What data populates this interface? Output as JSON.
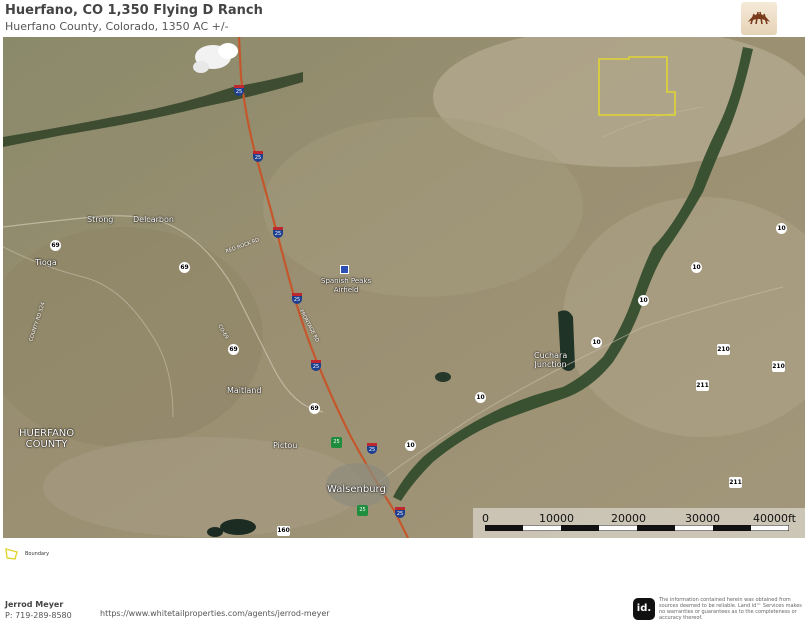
{
  "header": {
    "title": "Huerfano, CO 1,350 Flying D Ranch",
    "subtitle": "Huerfano County, Colorado, 1350 AC +/-"
  },
  "map": {
    "places": {
      "strong": "Strong",
      "delcarbon": "Delcarbon",
      "tioga": "Tioga",
      "airfield": "Spanish Peaks\nAirfield",
      "cuchara": "Cuchara\nJunction",
      "maitland": "Maitland",
      "pictou": "Pictou",
      "walsenburg": "Walsenburg",
      "county": "HUERFANO\nCOUNTY"
    },
    "roads": {
      "red_rock": "RED ROCK RD",
      "frontage": "FRONTAGE RD",
      "county_524": "COUNTY RD 524",
      "co_69": "CO-69"
    },
    "shields": {
      "i25": "25",
      "co69": "69",
      "co10": "10",
      "co210": "210",
      "co211": "211",
      "us160": "160",
      "us25": "25"
    },
    "scale": {
      "ticks": [
        "0",
        "10000",
        "20000",
        "30000",
        "40000ft"
      ]
    },
    "colors": {
      "boundary": "#e0d534",
      "interstate": "#c4572b"
    }
  },
  "legend": {
    "boundary_label": "Boundary"
  },
  "agent": {
    "name": "Jerrod Meyer",
    "phone": "P: 719-289-8580",
    "url": "https://www.whitetailproperties.com/agents/jerrod-meyer"
  },
  "footer": {
    "id_logo": "id.",
    "disclaimer": "The information contained herein was obtained from sources deemed to be reliable. Land id™ Services makes no warranties or guarantees as to the completeness or accuracy thereof."
  }
}
